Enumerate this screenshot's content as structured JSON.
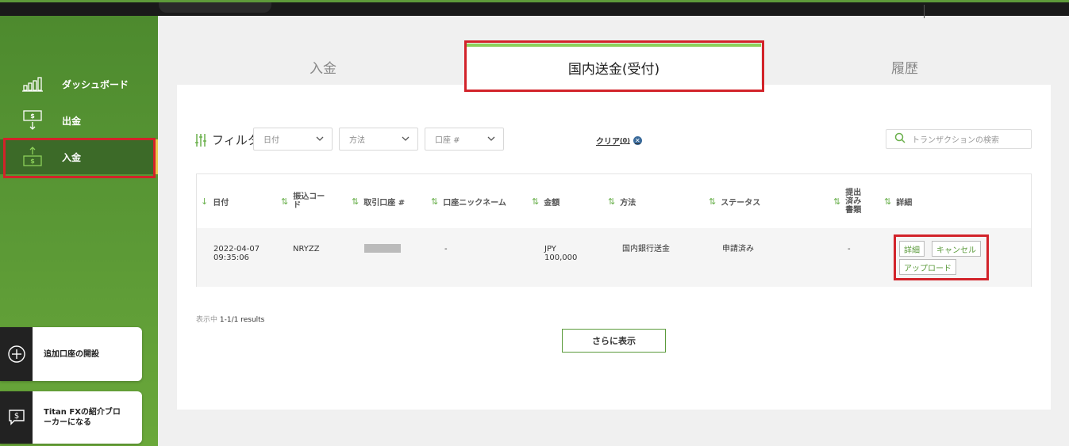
{
  "sidebar": {
    "items": [
      {
        "label": "ダッシュボード",
        "icon": "bar-chart-icon"
      },
      {
        "label": "出金",
        "icon": "withdraw-icon"
      },
      {
        "label": "入金",
        "icon": "deposit-icon"
      }
    ],
    "cards": [
      {
        "label": "追加口座の開設",
        "icon": "plus-circle-icon"
      },
      {
        "label": "Titan FXの紹介ブローカーになる",
        "icon": "dollar-chat-icon"
      }
    ]
  },
  "tabs": {
    "deposit": "入金",
    "domestic": "国内送金(受付)",
    "history": "履歴"
  },
  "filters": {
    "label": "フィルタ",
    "date": "日付",
    "method": "方法",
    "account": "口座 #",
    "clear": "クリア",
    "clear_count": "(0)",
    "search_placeholder": "トランザクションの検索"
  },
  "table": {
    "headers": [
      "日付",
      "振込コード",
      "取引口座 #",
      "口座ニックネーム",
      "金額",
      "方法",
      "ステータス",
      "提出済み書類",
      "詳細"
    ],
    "rows": [
      {
        "date": "2022-04-07",
        "time": "09:35:06",
        "code": "NRYZZ",
        "nickname": "-",
        "currency": "JPY",
        "amount": "100,000",
        "method": "国内銀行送金",
        "status": "申請済み",
        "docs": "-",
        "actions": [
          "詳細",
          "キャンセル",
          "アップロード"
        ]
      }
    ]
  },
  "results": {
    "prefix": "表示中",
    "range": "1-1/1 results"
  },
  "load_more": "さらに表示",
  "colors": {
    "brand_green": "#5c9a36",
    "highlight_red": "#d2232a",
    "tab_bar": "#8cd05a"
  }
}
